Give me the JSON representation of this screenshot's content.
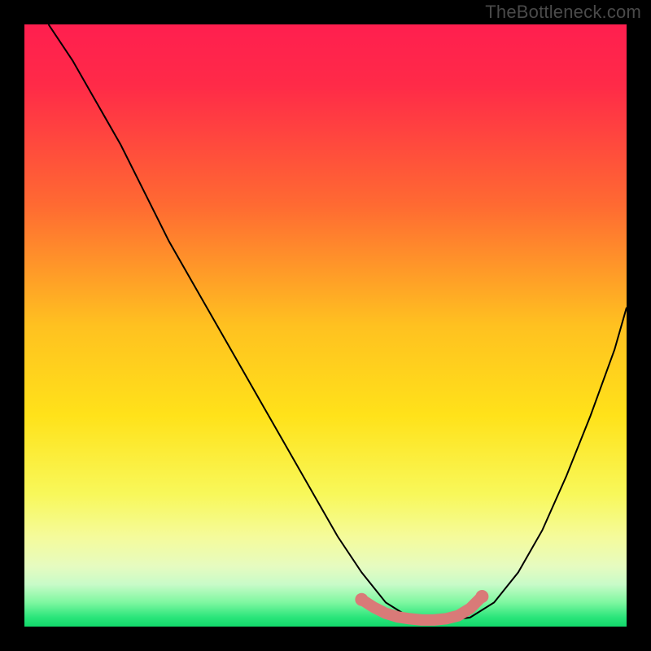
{
  "watermark": "TheBottleneck.com",
  "colors": {
    "frame": "#000000",
    "watermark": "#4a4a4a",
    "gradient_stops": [
      {
        "offset": 0.0,
        "color": "#ff1f4f"
      },
      {
        "offset": 0.1,
        "color": "#ff2a48"
      },
      {
        "offset": 0.3,
        "color": "#ff6a32"
      },
      {
        "offset": 0.5,
        "color": "#ffc120"
      },
      {
        "offset": 0.65,
        "color": "#ffe21a"
      },
      {
        "offset": 0.78,
        "color": "#f8f85a"
      },
      {
        "offset": 0.85,
        "color": "#f5fb9a"
      },
      {
        "offset": 0.9,
        "color": "#e6fbc0"
      },
      {
        "offset": 0.93,
        "color": "#c8fbc8"
      },
      {
        "offset": 0.96,
        "color": "#7ef7a0"
      },
      {
        "offset": 0.985,
        "color": "#29e57a"
      },
      {
        "offset": 1.0,
        "color": "#12d86b"
      }
    ],
    "curve": "#000000",
    "marker_fill": "#d97a78",
    "marker_stroke": "#b85a58"
  },
  "chart_data": {
    "type": "line",
    "title": "",
    "xlabel": "",
    "ylabel": "",
    "xlim": [
      0,
      100
    ],
    "ylim": [
      0,
      100
    ],
    "series": [
      {
        "name": "bottleneck-curve",
        "x": [
          4,
          8,
          12,
          16,
          20,
          24,
          28,
          32,
          36,
          40,
          44,
          48,
          52,
          56,
          60,
          64,
          67,
          70,
          74,
          78,
          82,
          86,
          90,
          94,
          98,
          100
        ],
        "y": [
          100,
          94,
          87,
          80,
          72,
          64,
          57,
          50,
          43,
          36,
          29,
          22,
          15,
          9,
          4,
          1.5,
          1,
          1,
          1.5,
          4,
          9,
          16,
          25,
          35,
          46,
          53
        ]
      }
    ],
    "markers": {
      "name": "optimal-range",
      "x": [
        56,
        58,
        60,
        62,
        64,
        66,
        68,
        70,
        72,
        74,
        76
      ],
      "y": [
        4.5,
        3.2,
        2.2,
        1.6,
        1.3,
        1.1,
        1.1,
        1.3,
        1.8,
        3.0,
        5.0
      ]
    }
  }
}
